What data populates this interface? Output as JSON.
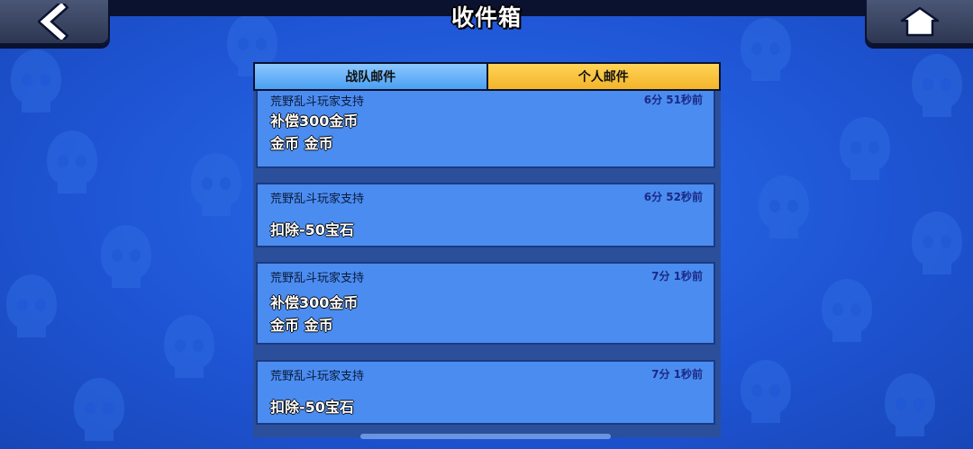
{
  "header": {
    "title": "收件箱",
    "back_icon": "chevron-left-icon",
    "home_icon": "home-icon"
  },
  "tabs": [
    {
      "label": "战队邮件",
      "active": false
    },
    {
      "label": "个人邮件",
      "active": true
    }
  ],
  "mails": [
    {
      "sender": "荒野乱斗玩家支持",
      "time": "6分 51秒前",
      "line1": "补偿300金币",
      "line2": "金币 金币"
    },
    {
      "sender": "荒野乱斗玩家支持",
      "time": "6分 52秒前",
      "line1": "扣除-50宝石",
      "line2": ""
    },
    {
      "sender": "荒野乱斗玩家支持",
      "time": "7分 1秒前",
      "line1": "补偿300金币",
      "line2": "金币 金币"
    },
    {
      "sender": "荒野乱斗玩家支持",
      "time": "7分 1秒前",
      "line1": "扣除-50宝石",
      "line2": ""
    }
  ],
  "colors": {
    "background": "#1f56d6",
    "tab_team": "#4aa0f2",
    "tab_personal": "#f3b42a",
    "mail_card": "#4b8cf0"
  }
}
